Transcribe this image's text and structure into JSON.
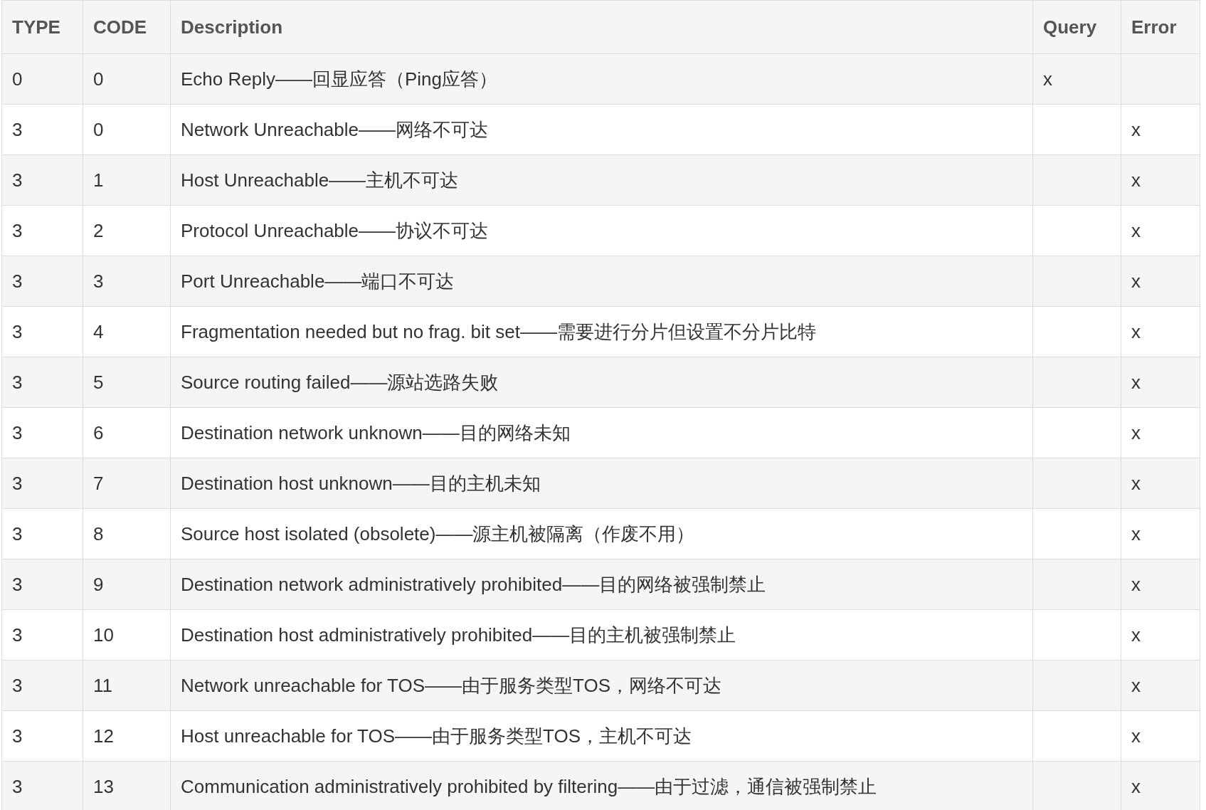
{
  "table": {
    "columns": [
      "TYPE",
      "CODE",
      "Description",
      "Query",
      "Error"
    ],
    "rows": [
      {
        "type": "0",
        "code": "0",
        "description": "Echo Reply——回显应答（Ping应答）",
        "query": "x"
      },
      {
        "type": "3",
        "code": "0",
        "description": "Network Unreachable——网络不可达",
        "error": "x"
      },
      {
        "type": "3",
        "code": "1",
        "description": "Host Unreachable——主机不可达",
        "error": "x"
      },
      {
        "type": "3",
        "code": "2",
        "description": "Protocol Unreachable——协议不可达",
        "error": "x"
      },
      {
        "type": "3",
        "code": "3",
        "description": "Port Unreachable——端口不可达",
        "error": "x"
      },
      {
        "type": "3",
        "code": "4",
        "description": "Fragmentation needed but no frag. bit set——需要进行分片但设置不分片比特",
        "error": "x"
      },
      {
        "type": "3",
        "code": "5",
        "description": "Source routing failed——源站选路失败",
        "error": "x"
      },
      {
        "type": "3",
        "code": "6",
        "description": "Destination network unknown——目的网络未知",
        "error": "x"
      },
      {
        "type": "3",
        "code": "7",
        "description": "Destination host unknown——目的主机未知",
        "error": "x"
      },
      {
        "type": "3",
        "code": "8",
        "description": "Source host isolated (obsolete)——源主机被隔离（作废不用）",
        "error": "x"
      },
      {
        "type": "3",
        "code": "9",
        "description": "Destination network administratively prohibited——目的网络被强制禁止",
        "error": "x"
      },
      {
        "type": "3",
        "code": "10",
        "description": "Destination host administratively prohibited——目的主机被强制禁止",
        "error": "x"
      },
      {
        "type": "3",
        "code": "11",
        "description": "Network unreachable for TOS——由于服务类型TOS，网络不可达",
        "error": "x"
      },
      {
        "type": "3",
        "code": "12",
        "description": "Host unreachable for TOS——由于服务类型TOS，主机不可达",
        "error": "x"
      },
      {
        "type": "3",
        "code": "13",
        "description": "Communication administratively prohibited by filtering——由于过滤，通信被强制禁止",
        "error": "x"
      }
    ]
  }
}
